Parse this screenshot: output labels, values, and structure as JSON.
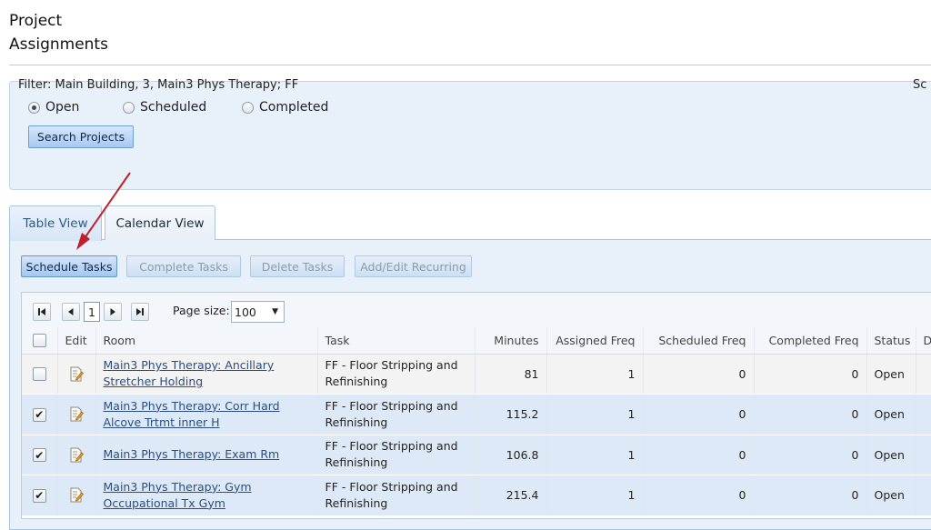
{
  "page": {
    "title_line1": "Project",
    "title_line2": "Assignments"
  },
  "filter_panel": {
    "radios": [
      {
        "label": "Open",
        "selected": true
      },
      {
        "label": "Scheduled",
        "selected": false
      },
      {
        "label": "Completed",
        "selected": false
      }
    ],
    "search_button": "Search Projects",
    "filter_text": "Filter: Main Building, 3, Main3 Phys Therapy; FF",
    "filter_cut_text": "Sc"
  },
  "tabs": [
    {
      "label": "Table View",
      "active": true
    },
    {
      "label": "Calendar View",
      "active": false
    }
  ],
  "actions": {
    "schedule": "Schedule Tasks",
    "complete": "Complete Tasks",
    "delete": "Delete Tasks",
    "recurring": "Add/Edit Recurring"
  },
  "pager": {
    "current_page": "1",
    "page_size_label": "Page size:",
    "page_size": "100"
  },
  "table": {
    "headers": {
      "edit": "Edit",
      "room": "Room",
      "task": "Task",
      "minutes": "Minutes",
      "assigned": "Assigned Freq",
      "scheduled": "Scheduled Freq",
      "completed": "Completed Freq",
      "status": "Status",
      "cut": "D"
    },
    "rows": [
      {
        "checked": false,
        "room": "Main3 Phys Therapy: Ancillary Stretcher Holding",
        "task": "FF - Floor Stripping and Refinishing",
        "minutes": "81",
        "assigned": "1",
        "scheduled": "0",
        "completed": "0",
        "status": "Open"
      },
      {
        "checked": true,
        "room": "Main3 Phys Therapy: Corr Hard Alcove Trtmt inner H",
        "task": "FF - Floor Stripping and Refinishing",
        "minutes": "115.2",
        "assigned": "1",
        "scheduled": "0",
        "completed": "0",
        "status": "Open"
      },
      {
        "checked": true,
        "room": "Main3 Phys Therapy: Exam Rm",
        "task": "FF - Floor Stripping and Refinishing",
        "minutes": "106.8",
        "assigned": "1",
        "scheduled": "0",
        "completed": "0",
        "status": "Open"
      },
      {
        "checked": true,
        "room": "Main3 Phys Therapy: Gym Occupational Tx Gym",
        "task": "FF - Floor Stripping and Refinishing",
        "minutes": "215.4",
        "assigned": "1",
        "scheduled": "0",
        "completed": "0",
        "status": "Open"
      }
    ]
  },
  "colors": {
    "arrow": "#c0202a",
    "link": "#2a4e82",
    "selected_row": "#dde9f6"
  }
}
